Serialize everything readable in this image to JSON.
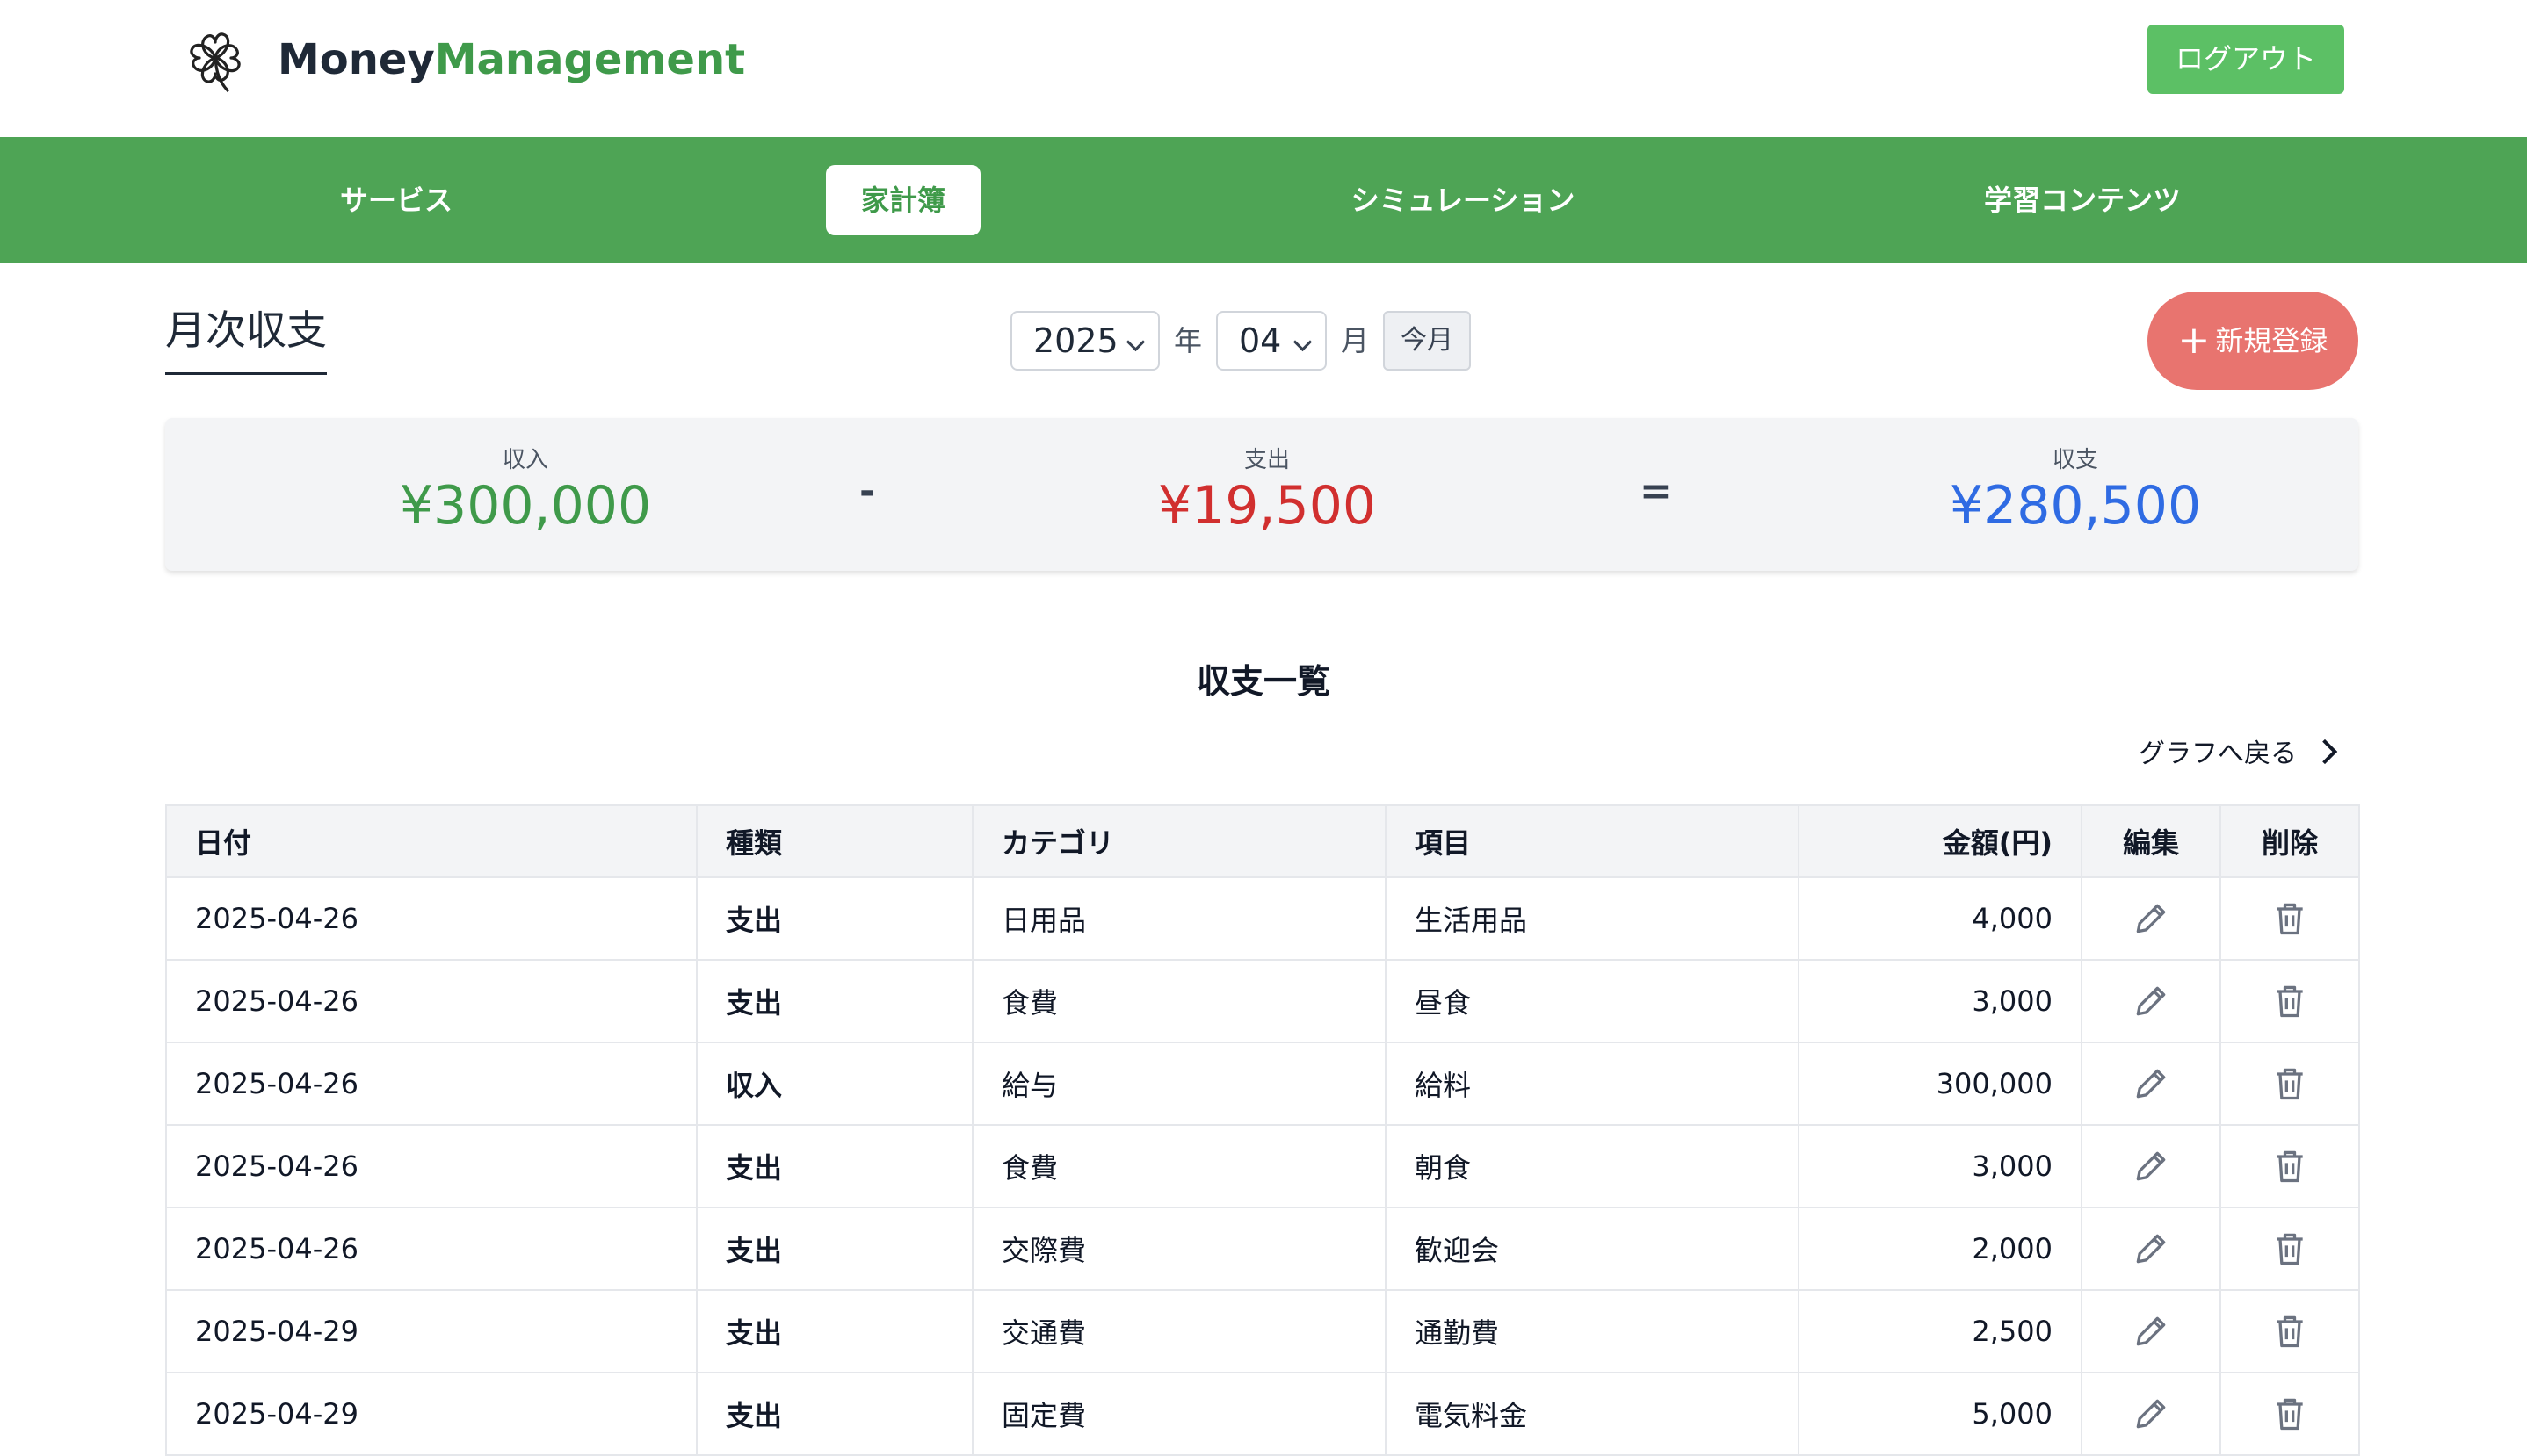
{
  "header": {
    "brand_part1": "Money",
    "brand_part2": "Management",
    "logout_label": "ログアウト",
    "brand_color": "#3f9a4a"
  },
  "nav": {
    "items": [
      {
        "label": "サービス"
      },
      {
        "label": "家計簿",
        "active": true
      },
      {
        "label": "シミュレーション"
      },
      {
        "label": "学習コンテンツ"
      }
    ]
  },
  "page": {
    "title": "月次収支",
    "year": "2025",
    "year_unit": "年",
    "month": "04",
    "month_unit": "月",
    "this_month_label": "今月",
    "new_entry_label": "新規登録",
    "new_entry_icon": "plus-icon"
  },
  "summary": {
    "income_label": "収入",
    "income_value": "¥300,000",
    "minus_op": "-",
    "expense_label": "支出",
    "expense_value": "¥19,500",
    "equals_op": "=",
    "balance_label": "収支",
    "balance_value": "¥280,500",
    "income_color": "#3f9a4a",
    "expense_color": "#d12f2f",
    "balance_color": "#2f6be3"
  },
  "list": {
    "title": "収支一覧",
    "back_link": "グラフへ戻る",
    "headers": {
      "date": "日付",
      "type": "種類",
      "category": "カテゴリ",
      "item": "項目",
      "amount": "金額(円)",
      "edit": "編集",
      "delete": "削除"
    },
    "rows": [
      {
        "date": "2025-04-26",
        "type": "支出",
        "kind": "expense",
        "category": "日用品",
        "item": "生活用品",
        "amount": "4,000"
      },
      {
        "date": "2025-04-26",
        "type": "支出",
        "kind": "expense",
        "category": "食費",
        "item": "昼食",
        "amount": "3,000"
      },
      {
        "date": "2025-04-26",
        "type": "収入",
        "kind": "income",
        "category": "給与",
        "item": "給料",
        "amount": "300,000"
      },
      {
        "date": "2025-04-26",
        "type": "支出",
        "kind": "expense",
        "category": "食費",
        "item": "朝食",
        "amount": "3,000"
      },
      {
        "date": "2025-04-26",
        "type": "支出",
        "kind": "expense",
        "category": "交際費",
        "item": "歓迎会",
        "amount": "2,000"
      },
      {
        "date": "2025-04-29",
        "type": "支出",
        "kind": "expense",
        "category": "交通費",
        "item": "通勤費",
        "amount": "2,500"
      },
      {
        "date": "2025-04-29",
        "type": "支出",
        "kind": "expense",
        "category": "固定費",
        "item": "電気料金",
        "amount": "5,000"
      }
    ]
  }
}
